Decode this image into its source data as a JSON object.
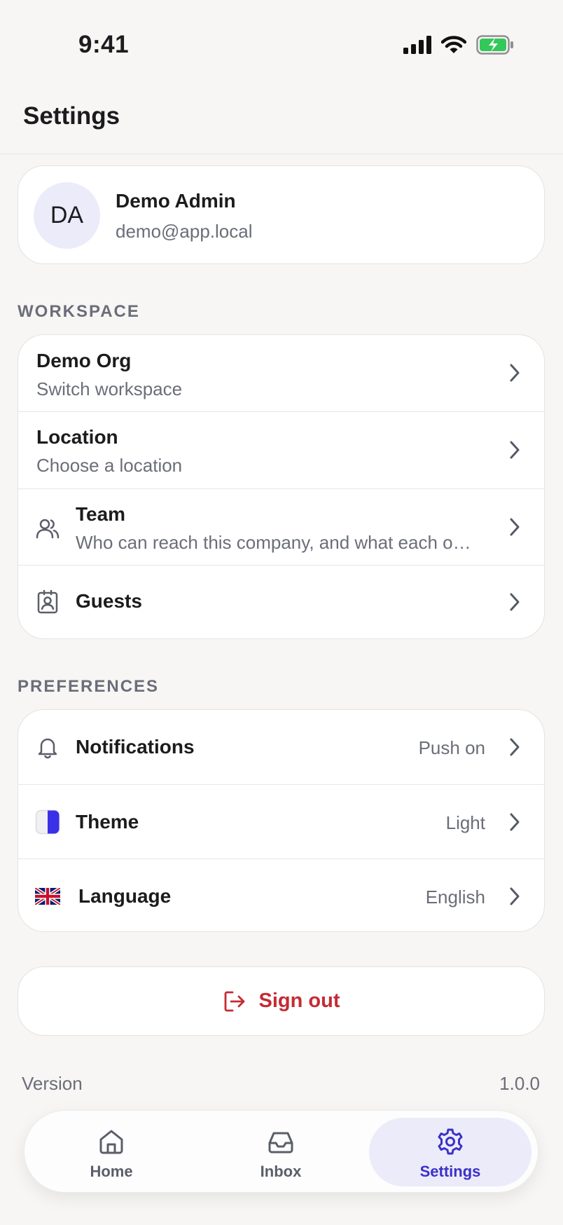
{
  "status_bar": {
    "time": "9:41"
  },
  "header": {
    "title": "Settings"
  },
  "profile": {
    "initials": "DA",
    "name": "Demo Admin",
    "email": "demo@app.local"
  },
  "workspace": {
    "section_label": "WORKSPACE",
    "rows": [
      {
        "title": "Demo Org",
        "subtitle": "Switch workspace",
        "icon": "none"
      },
      {
        "title": "Location",
        "subtitle": "Choose a location",
        "icon": "none"
      },
      {
        "title": "Team",
        "subtitle": "Who can reach this company, and what each o…",
        "icon": "users-icon"
      },
      {
        "title": "Guests",
        "subtitle": "",
        "icon": "badge-icon"
      }
    ]
  },
  "preferences": {
    "section_label": "PREFERENCES",
    "rows": [
      {
        "title": "Notifications",
        "value": "Push on",
        "icon": "bell-icon"
      },
      {
        "title": "Theme",
        "value": "Light",
        "icon": "theme-swatch-icon"
      },
      {
        "title": "Language",
        "value": "English",
        "icon": "uk-flag-icon"
      }
    ]
  },
  "sign_out": {
    "label": "Sign out"
  },
  "version": {
    "label": "Version",
    "value": "1.0.0"
  },
  "tab_bar": {
    "tabs": [
      {
        "label": "Home",
        "icon": "home-icon",
        "active": false
      },
      {
        "label": "Inbox",
        "icon": "inbox-icon",
        "active": false
      },
      {
        "label": "Settings",
        "icon": "gear-icon",
        "active": true
      }
    ]
  },
  "colors": {
    "accent": "#3a31c8",
    "accent_bg": "#ecebfa",
    "danger": "#c42b34",
    "battery": "#34c759",
    "background": "#f7f6f5"
  }
}
